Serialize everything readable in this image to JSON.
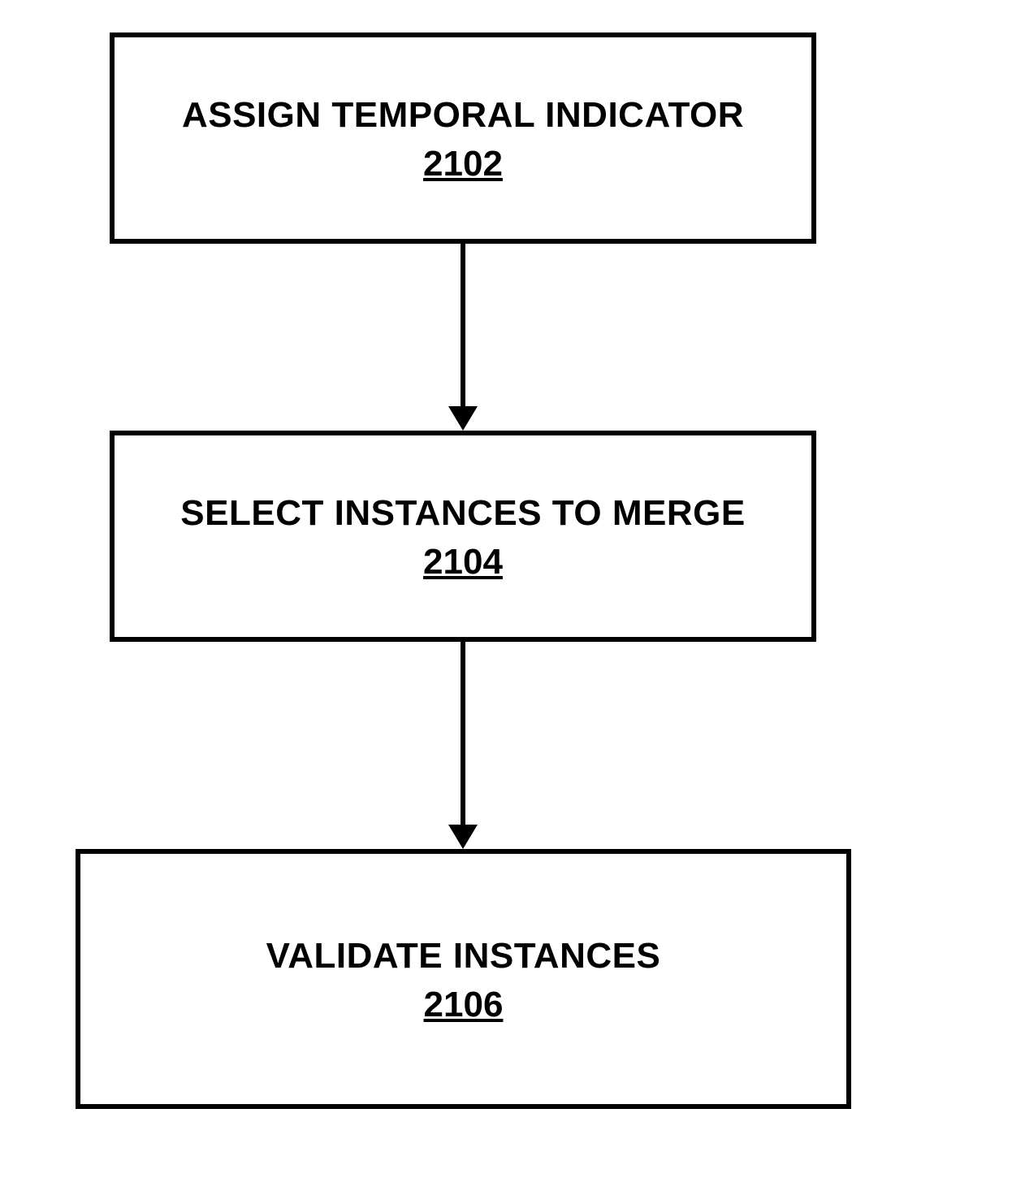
{
  "boxes": [
    {
      "title": "ASSIGN TEMPORAL INDICATOR",
      "number": "2102"
    },
    {
      "title": "SELECT INSTANCES TO MERGE",
      "number": "2104"
    },
    {
      "title": "VALIDATE INSTANCES",
      "number": "2106"
    }
  ]
}
